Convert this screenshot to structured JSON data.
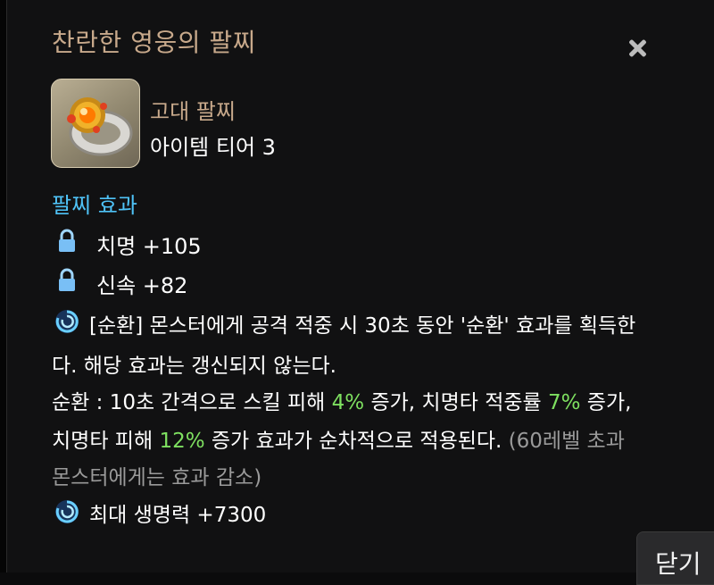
{
  "title": "찬란한 영웅의 팔찌",
  "item": {
    "type": "고대 팔찌",
    "tier": "아이템 티어 3",
    "icon": "bracelet-icon"
  },
  "effects": {
    "section_title": "팔찌 효과",
    "stats": [
      {
        "icon": "lock-icon",
        "label": "치명 +105"
      },
      {
        "icon": "lock-icon",
        "label": "신속 +82"
      }
    ],
    "special": {
      "icon": "swirl-orb-icon",
      "line1": "[순환] 몬스터에게 공격 적중 시 30초 동안 '순환' 효과를 획득한",
      "line2": "다. 해당 효과는 갱신되지 않는다.",
      "line3a": "순환 : 10초 간격으로 스킬 피해 ",
      "line3b": "4%",
      "line3c": " 증가, 치명타 적중률 ",
      "line3d": "7%",
      "line3e": " 증가,",
      "line4a": "치명타 피해 ",
      "line4b": "12%",
      "line4c": " 증가 효과가 순차적으로 적용된다. ",
      "line4d": "(60레벨 초과",
      "line5": "몬스터에게는 효과 감소)"
    },
    "hp": {
      "icon": "swirl-orb-icon",
      "label": "최대 생명력 +7300"
    }
  },
  "buttons": {
    "close_label": "닫기"
  },
  "colors": {
    "title": "#c8a98b",
    "section": "#4fc3f7",
    "highlight": "#7ee060",
    "dim": "#9a9a9a"
  }
}
